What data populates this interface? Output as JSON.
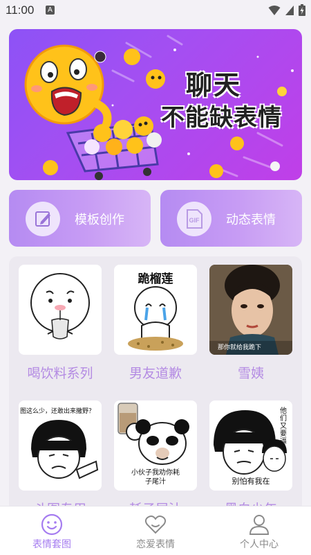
{
  "status": {
    "time": "11:00",
    "notification_glyph": "A"
  },
  "banner": {
    "title_line1": "聊天",
    "title_line2": "不能缺表情"
  },
  "quick_actions": [
    {
      "label": "模板创作",
      "icon": "edit-icon"
    },
    {
      "label": "动态表情",
      "icon": "gif-icon",
      "icon_text": "GIF"
    }
  ],
  "sets": [
    {
      "label": "喝饮料系列"
    },
    {
      "label": "男友道歉",
      "caption": "跪榴莲"
    },
    {
      "label": "雪姨",
      "caption": "那你就给我跪下"
    },
    {
      "label": "斗图专用",
      "caption": "图这么少，还敢出来撒野？"
    },
    {
      "label": "耗子尾汁",
      "caption": "小伙子我劝你耗子尾汁"
    },
    {
      "label": "黑白少年",
      "caption": "别怕有我在",
      "side_caption": "他们又要逼"
    }
  ],
  "tabs": [
    {
      "label": "表情套图",
      "icon": "smiley-icon",
      "active": true
    },
    {
      "label": "恋爱表情",
      "icon": "heart-icon",
      "active": false
    },
    {
      "label": "个人中心",
      "icon": "person-icon",
      "active": false
    }
  ],
  "colors": {
    "accent": "#a57cf0",
    "label": "#b48be3",
    "inactive": "#8a8a8a"
  }
}
